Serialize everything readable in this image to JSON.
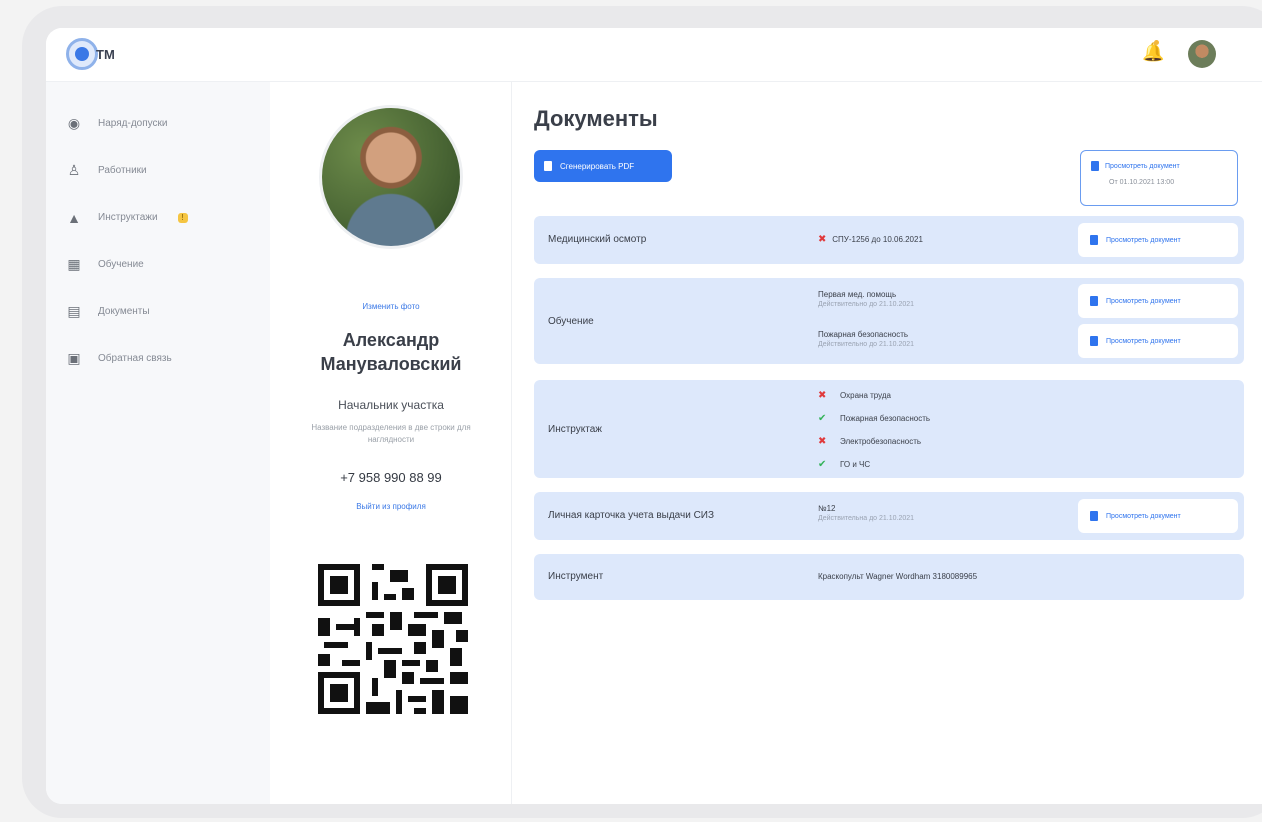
{
  "brand": {
    "logo_text": "TM"
  },
  "sidebar": {
    "items": [
      {
        "label": "Наряд-допуски",
        "icon": "globe-icon"
      },
      {
        "label": "Работники",
        "icon": "worker-icon"
      },
      {
        "label": "Инструктажи",
        "icon": "hierarchy-icon",
        "badge": "!"
      },
      {
        "label": "Обучение",
        "icon": "books-icon"
      },
      {
        "label": "Документы",
        "icon": "documents-icon"
      },
      {
        "label": "Обратная связь",
        "icon": "feedback-icon"
      }
    ]
  },
  "profile": {
    "change_photo": "Изменить фото",
    "name_line1": "Александр",
    "name_line2": "Мануваловский",
    "role": "Начальник участка",
    "department": "Название подразделения в две строки для наглядности",
    "phone": "+7 958 990 88 99",
    "logout": "Выйти из профиля"
  },
  "main": {
    "title": "Документы",
    "generate_pdf": "Сгенерировать PDF",
    "view_doc": "Просмотреть документ",
    "view_doc_top_date": "От 01.10.2021 13:00",
    "rows": {
      "medical": {
        "label": "Медицинский осмотр",
        "value": "СПУ-1256 до 10.06.2021"
      },
      "training": {
        "label": "Обучение",
        "items": [
          {
            "title": "Первая мед. помощь",
            "sub": "Действительно до 21.10.2021"
          },
          {
            "title": "Пожарная безопасность",
            "sub": "Действительно до 21.10.2021"
          }
        ]
      },
      "briefing": {
        "label": "Инструктаж",
        "items": [
          {
            "text": "Охрана труда",
            "status": "fail"
          },
          {
            "text": "Пожарная безопасность",
            "status": "ok"
          },
          {
            "text": "Электробезопасность",
            "status": "fail"
          },
          {
            "text": "ГО и ЧС",
            "status": "ok"
          }
        ]
      },
      "ppe": {
        "label": "Личная карточка учета выдачи СИЗ",
        "value": "№12",
        "sub": "Действительна до 21.10.2021"
      },
      "tool": {
        "label": "Инструмент",
        "value": "Краскопульт Wagner Wordham 3180089965"
      }
    }
  },
  "colors": {
    "accent": "#2f74ee",
    "row_bg": "#dde8fb",
    "fail": "#e0393b",
    "ok": "#35b35a"
  }
}
